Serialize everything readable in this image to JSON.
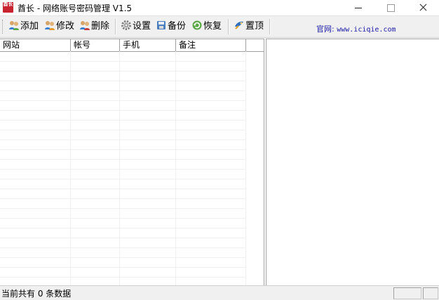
{
  "window": {
    "title": "酋长 - 网络账号密码管理 V1.5",
    "app_icon_text": "酋长",
    "controls": [
      "minimize",
      "maximize",
      "close"
    ]
  },
  "toolbar": {
    "buttons": [
      {
        "label": "添加",
        "icon": "users-add-icon"
      },
      {
        "label": "修改",
        "icon": "users-edit-icon"
      },
      {
        "label": "删除",
        "icon": "users-delete-icon"
      },
      {
        "label": "设置",
        "icon": "gear-icon"
      },
      {
        "label": "备份",
        "icon": "backup-icon"
      },
      {
        "label": "恢复",
        "icon": "restore-icon"
      },
      {
        "label": "置顶",
        "icon": "pin-top-icon"
      }
    ],
    "website_label": "官网:",
    "website_url": "www.iciqie.com"
  },
  "table": {
    "columns": [
      "网站",
      "帐号",
      "手机",
      "备注"
    ],
    "rows": []
  },
  "status": {
    "text": "当前共有 0 条数据"
  },
  "colors": {
    "accent_red": "#c8242f",
    "link_blue": "#1a1aa8",
    "toolbar_bg": "#f0f0f0"
  }
}
